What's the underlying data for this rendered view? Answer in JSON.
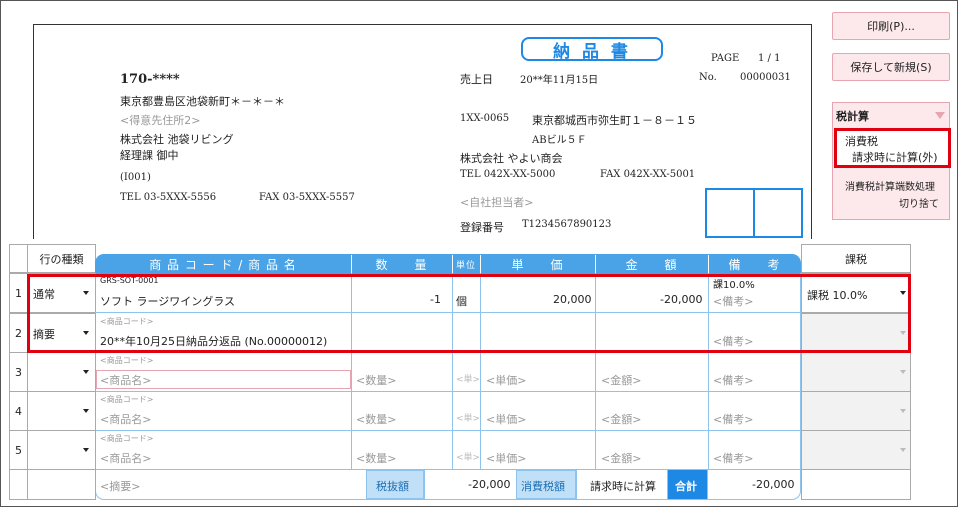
{
  "document": {
    "title": "納 品 書",
    "page_label": "PAGE",
    "page_value": "1 / 1",
    "postal": "170-****",
    "address": "東京都豊島区池袋新町＊－＊－＊",
    "addr2_placeholder": "<得意先住所2>",
    "customer_company": "株式会社 池袋リビング",
    "customer_dept": "経理課 御中",
    "customer_code": "(I001)",
    "customer_tel": "TEL 03-5XXX-5556",
    "customer_fax": "FAX 03-5XXX-5557",
    "sales_date_label": "売上日",
    "sales_date": "20**年11月15日",
    "no_label": "No.",
    "no_value": "00000031",
    "company_postal": "1XX-0065",
    "company_address": "東京都城西市弥生町１－８－１５",
    "company_building": "ABビル５Ｆ",
    "company_name": "株式会社 やよい商会",
    "company_tel": "TEL 042X-XX-5000",
    "company_fax": "FAX 042X-XX-5001",
    "staff_placeholder": "<自社担当者>",
    "reg_label": "登録番号",
    "reg_number": "T1234567890123"
  },
  "side_panel": {
    "print_button": "印刷(P)...",
    "save_new_button": "保存して新規(S)",
    "tax_calc_label": "税計算",
    "tax_label": "消費税",
    "tax_value": "請求時に計算(外)",
    "rounding_label": "消費税計算端数処理",
    "rounding_value": "切り捨て"
  },
  "grid": {
    "headers": {
      "row_type": "行の種類",
      "product": "商 品 コ ー ド / 商 品 名",
      "qty": "数　　量",
      "unit": "単位",
      "price": "単　　価",
      "amount": "金　　額",
      "note": "備　　考",
      "taxation": "課税"
    },
    "rows": [
      {
        "num": "1",
        "type": "通常",
        "code": "GRS-SOT-0001",
        "name": "ソフト ラージワイングラス",
        "qty": "-1",
        "unit": "個",
        "price": "20,000",
        "amount": "-20,000",
        "note_top": "課10.0%",
        "note": "<備考>",
        "tax": "課税 10.0%"
      },
      {
        "num": "2",
        "type": "摘要",
        "code": "<商品コード>",
        "name": "20**年10月25日納品分返品 (No.00000012)",
        "qty": "",
        "unit": "",
        "price": "",
        "amount": "",
        "note_top": "",
        "note": "<備考>",
        "tax": ""
      },
      {
        "num": "3",
        "type": "",
        "code": "<商品コード>",
        "name": "<商品名>",
        "qty": "<数量>",
        "unit": "<単>",
        "price": "<単価>",
        "amount": "<金額>",
        "note_top": "",
        "note": "<備考>",
        "tax": ""
      },
      {
        "num": "4",
        "type": "",
        "code": "<商品コード>",
        "name": "<商品名>",
        "qty": "<数量>",
        "unit": "<単>",
        "price": "<単価>",
        "amount": "<金額>",
        "note_top": "",
        "note": "<備考>",
        "tax": ""
      },
      {
        "num": "5",
        "type": "",
        "code": "<商品コード>",
        "name": "<商品名>",
        "qty": "<数量>",
        "unit": "<単>",
        "price": "<単価>",
        "amount": "<金額>",
        "note_top": "",
        "note": "<備考>",
        "tax": ""
      }
    ],
    "footer": {
      "summary_placeholder": "<摘要>",
      "pretax_label": "税抜額",
      "pretax_value": "-20,000",
      "tax_label": "消費税額",
      "tax_value": "請求時に計算",
      "total_label": "合計",
      "total_value": "-20,000"
    }
  },
  "colors": {
    "header_blue": "#4aa3e6",
    "grid_line": "#8ec3ee",
    "highlight_red": "#e0000f",
    "button_pink": "#fde9ec",
    "accent_blue": "#1e88e5"
  }
}
